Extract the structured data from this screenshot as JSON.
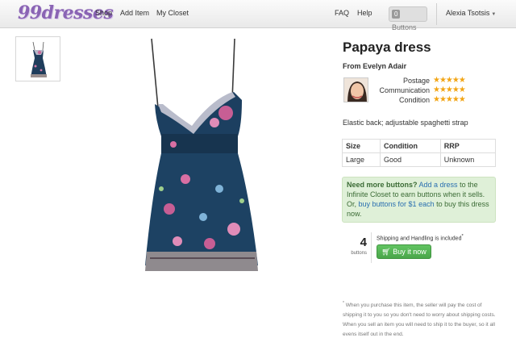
{
  "nav": {
    "logo": "99dresses",
    "links": [
      "Shop",
      "Add Item",
      "My Closet"
    ],
    "faq": "FAQ",
    "help": "Help",
    "buttons_count": "0",
    "buttons_label": "Buttons",
    "user": "Alexia Tsotsis"
  },
  "product": {
    "title": "Papaya dress",
    "seller": "From Evelyn Adair",
    "ratings": [
      {
        "label": "Postage",
        "stars": "★★★★★",
        "value": 5
      },
      {
        "label": "Communication",
        "stars": "★★★★★",
        "value": 5
      },
      {
        "label": "Condition",
        "stars": "★★★★★",
        "value": 5
      }
    ],
    "description": "Elastic back; adjustable spaghetti strap",
    "specs": {
      "headers": [
        "Size",
        "Condition",
        "RRP"
      ],
      "values": [
        "Large",
        "Good",
        "Unknown"
      ]
    }
  },
  "promo": {
    "bold": "Need more buttons?",
    "link1": "Add a dress",
    "text1": " to the Infinite Closet to earn buttons when it sells. Or, ",
    "link2": "buy buttons for $1 each",
    "text2": " to buy this dress now."
  },
  "purchase": {
    "price": "4",
    "unit": "buttons",
    "shipping": "Shipping and Handling is included",
    "shipping_mark": "*",
    "buy_label": "Buy it now"
  },
  "footnote": {
    "mark": "*",
    "text": " When you purchase this item, the seller will pay the cost of shipping it to you so you don't need to worry about shipping costs. When you sell an item you will need to ship it to the buyer, so it all evens itself out in the end."
  },
  "colors": {
    "brand": "#8a64b4",
    "star": "#f2a516",
    "buy_button": "#4aa64a",
    "promo_bg": "#dff0d8",
    "link": "#2a6fb0"
  }
}
